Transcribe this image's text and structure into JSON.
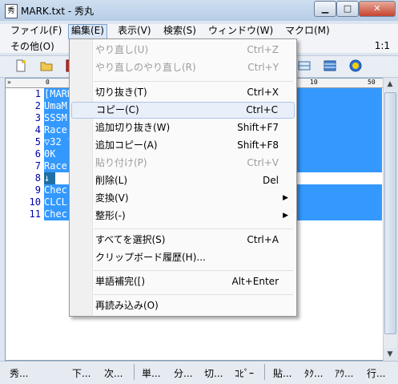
{
  "window": {
    "title": "MARK.txt - 秀丸"
  },
  "menubar": {
    "items": [
      "ファイル(F)",
      "編集(E)",
      "表示(V)",
      "検索(S)",
      "ウィンドウ(W)",
      "マクロ(M)",
      "その他(O)"
    ],
    "ratio": "1:1"
  },
  "ruler": {
    "labels": [
      "0",
      "10",
      "50"
    ]
  },
  "editor": {
    "line_numbers": [
      "1",
      "2",
      "3",
      "4",
      "5",
      "6",
      "7",
      "8",
      "9",
      "10",
      "11"
    ],
    "lines": [
      "[MARK",
      "UmaM                                            消落マ消落TO攻",
      "SSSM",
      "Race                                            ○  ○  ▲  ▲",
      "▽32                                             ??低??低??修↑",
      "0K",
      "Race                                            EA3A0311E55F8",
      "↓",
      "Chec                                            MHoSoHxSxLHAG",
      "CLCL",
      "Chec                                            3333333333531"
    ]
  },
  "edit_menu": {
    "items": [
      {
        "label": "やり直し(U)",
        "shortcut": "Ctrl+Z",
        "disabled": true
      },
      {
        "label": "やり直しのやり直し(R)",
        "shortcut": "Ctrl+Y",
        "disabled": true
      },
      {
        "label": "切り抜き(T)",
        "shortcut": "Ctrl+X"
      },
      {
        "label": "コピー(C)",
        "shortcut": "Ctrl+C",
        "highlighted": true
      },
      {
        "label": "追加切り抜き(W)",
        "shortcut": "Shift+F7"
      },
      {
        "label": "追加コピー(A)",
        "shortcut": "Shift+F8"
      },
      {
        "label": "貼り付け(P)",
        "shortcut": "Ctrl+V",
        "disabled": true
      },
      {
        "label": "削除(L)",
        "shortcut": "Del"
      },
      {
        "label": "変換(V)",
        "submenu": true
      },
      {
        "label": "整形(-)",
        "submenu": true
      },
      {
        "label": "すべてを選択(S)",
        "shortcut": "Ctrl+A"
      },
      {
        "label": "クリップボード履歴(H)..."
      },
      {
        "label": "単語補完([)",
        "shortcut": "Alt+Enter"
      },
      {
        "label": "再読み込み(O)"
      }
    ]
  },
  "function_keys": [
    "秀...",
    "下...",
    "次...",
    "単...",
    "分...",
    "切...",
    "ｺﾋﾟｰ",
    "貼...",
    "ﾀｸ...",
    "ｱｳ...",
    "行..."
  ]
}
